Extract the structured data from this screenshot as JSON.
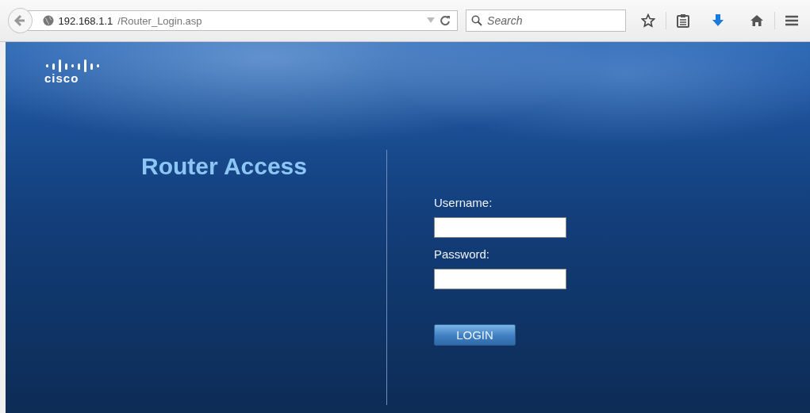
{
  "browser": {
    "url_host": "192.168.1.1",
    "url_path": "/Router_Login.asp",
    "search": {
      "placeholder": "Search"
    }
  },
  "page": {
    "logo_text": "cisco",
    "title": "Router Access",
    "form": {
      "fields": [
        {
          "label": "Username:"
        },
        {
          "label": "Password:"
        }
      ],
      "button": "LOGIN"
    }
  }
}
